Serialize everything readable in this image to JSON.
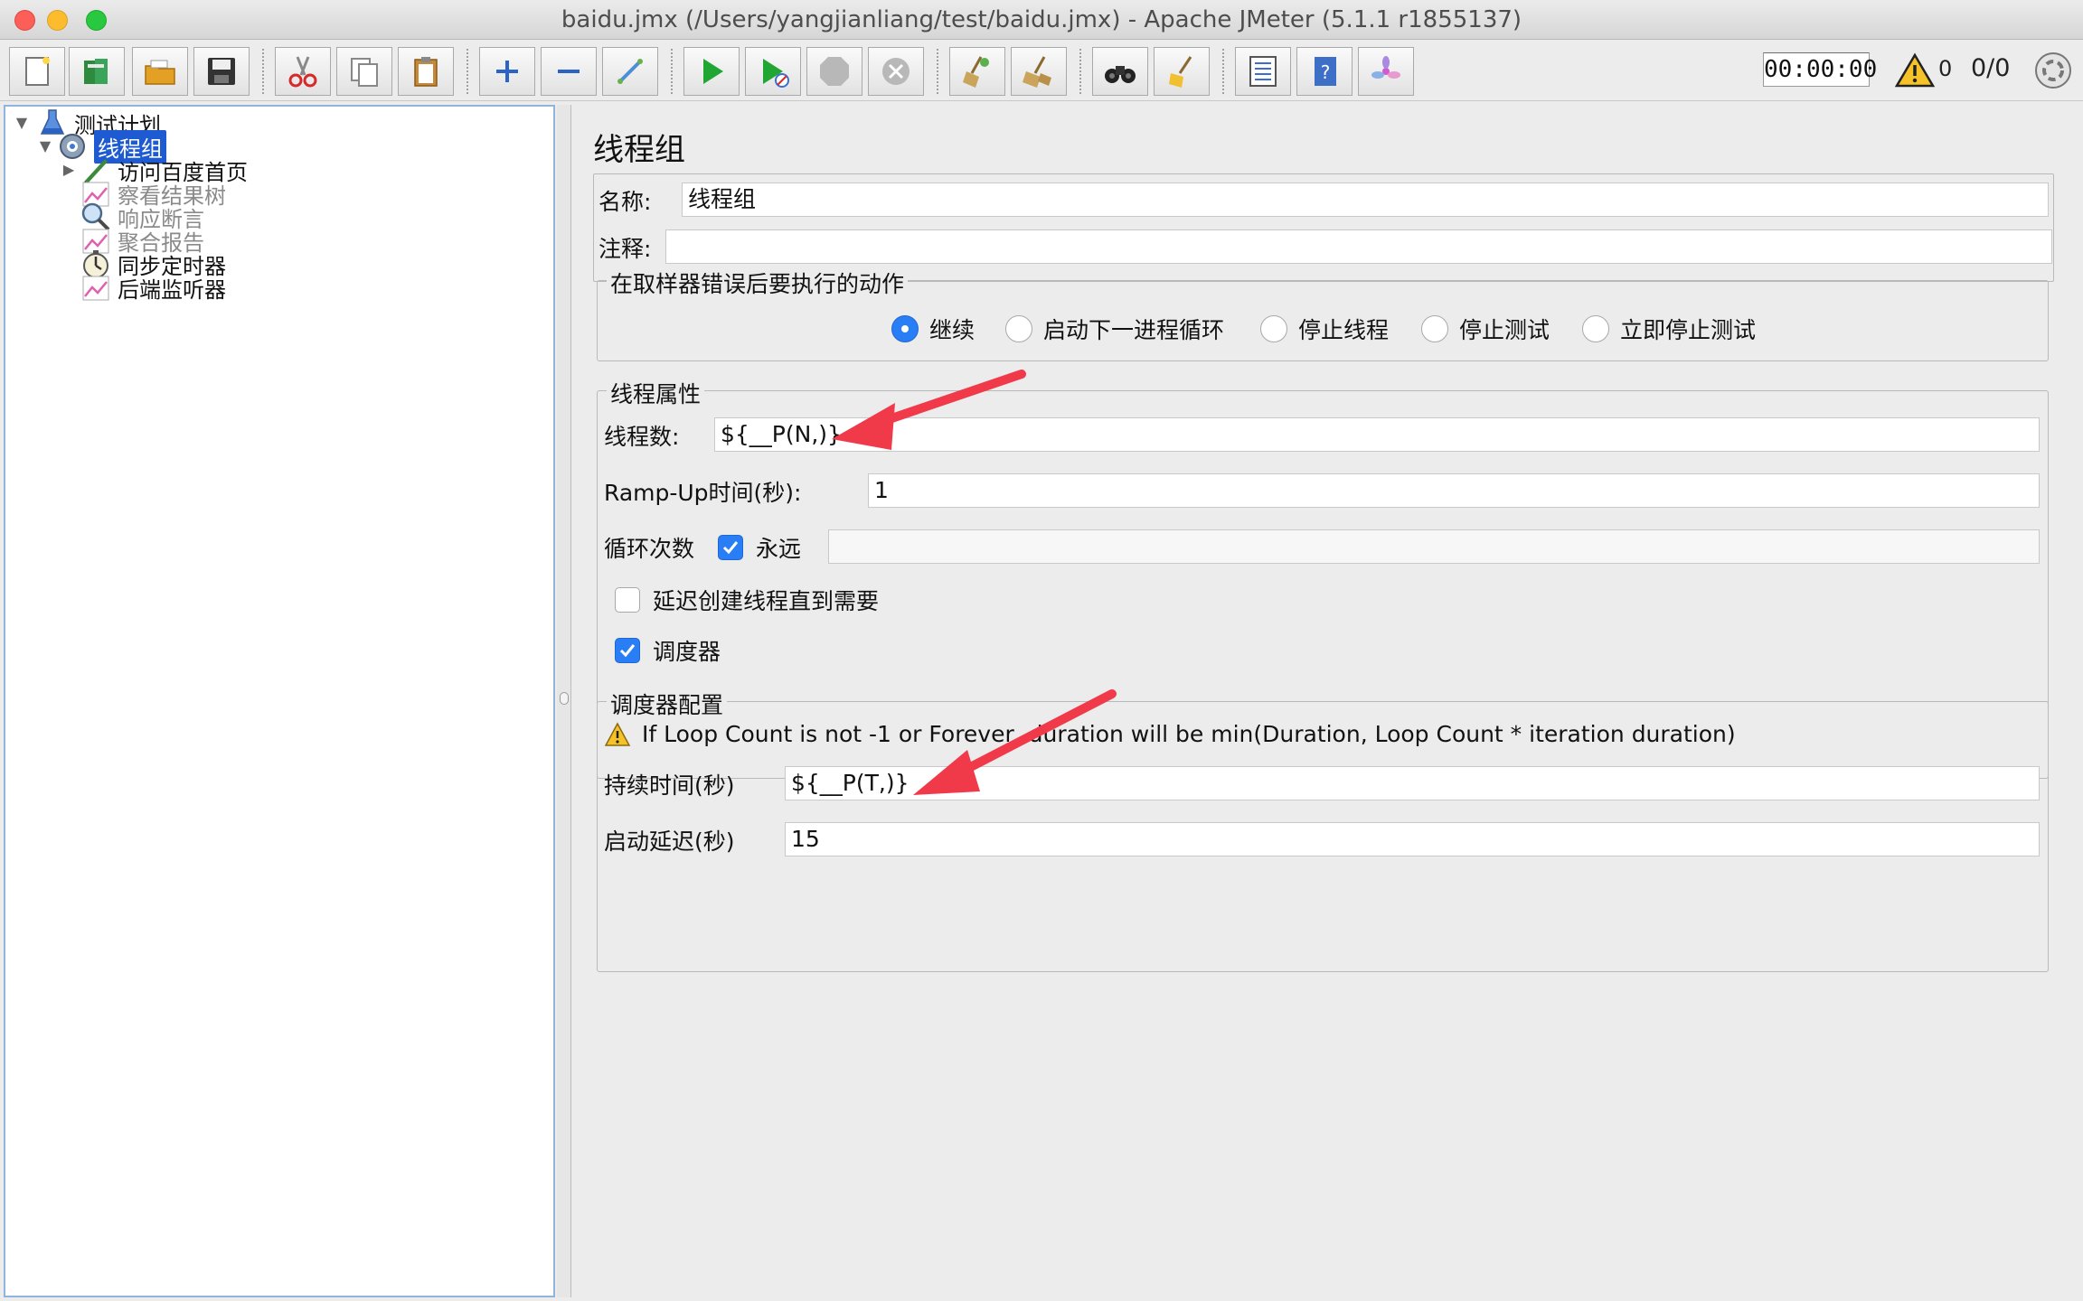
{
  "window": {
    "title": "baidu.jmx (/Users/yangjianliang/test/baidu.jmx) - Apache JMeter (5.1.1 r1855137)"
  },
  "toolbar": {
    "timer": "00:00:00",
    "warning_count": "0",
    "thread_ratio": "0/0"
  },
  "tree": {
    "items": [
      {
        "label": "测试计划",
        "icon": "flask-icon",
        "expanded": true
      },
      {
        "label": "线程组",
        "icon": "gear-icon",
        "expanded": true,
        "selected": true
      },
      {
        "label": "访问百度首页",
        "icon": "sampler-icon",
        "expanded": false
      },
      {
        "label": "察看结果树",
        "icon": "listener-icon",
        "disabled": true
      },
      {
        "label": "响应断言",
        "icon": "magnifier-icon",
        "disabled": true
      },
      {
        "label": "聚合报告",
        "icon": "listener-icon",
        "disabled": true
      },
      {
        "label": "同步定时器",
        "icon": "timer-icon"
      },
      {
        "label": "后端监听器",
        "icon": "listener-icon"
      }
    ]
  },
  "panel": {
    "title": "线程组",
    "name_label": "名称:",
    "name_value": "线程组",
    "comment_label": "注释:",
    "comment_value": "",
    "error_action": {
      "legend": "在取样器错误后要执行的动作",
      "options": [
        "继续",
        "启动下一进程循环",
        "停止线程",
        "停止测试",
        "立即停止测试"
      ],
      "selected": "继续"
    },
    "thread_props": {
      "legend": "线程属性",
      "threads_label": "线程数:",
      "threads_value": "${__P(N,)}",
      "rampup_label": "Ramp-Up时间(秒):",
      "rampup_value": "1",
      "loop_label": "循环次数",
      "forever_label": "永远",
      "forever_checked": true,
      "loop_value": "",
      "delay_label": "延迟创建线程直到需要",
      "delay_checked": false,
      "scheduler_label": "调度器",
      "scheduler_checked": true
    },
    "scheduler_config": {
      "legend": "调度器配置",
      "notice": "If Loop Count is not -1 or Forever, duration will be min(Duration, Loop Count * iteration duration)",
      "duration_label": "持续时间(秒)",
      "duration_value": "${__P(T,)}",
      "startup_label": "启动延迟(秒)",
      "startup_value": "15"
    }
  },
  "colors": {
    "accent": "#2a7ef5",
    "selection": "#1e5bd2",
    "annotation_arrow": "#f03a4a"
  }
}
